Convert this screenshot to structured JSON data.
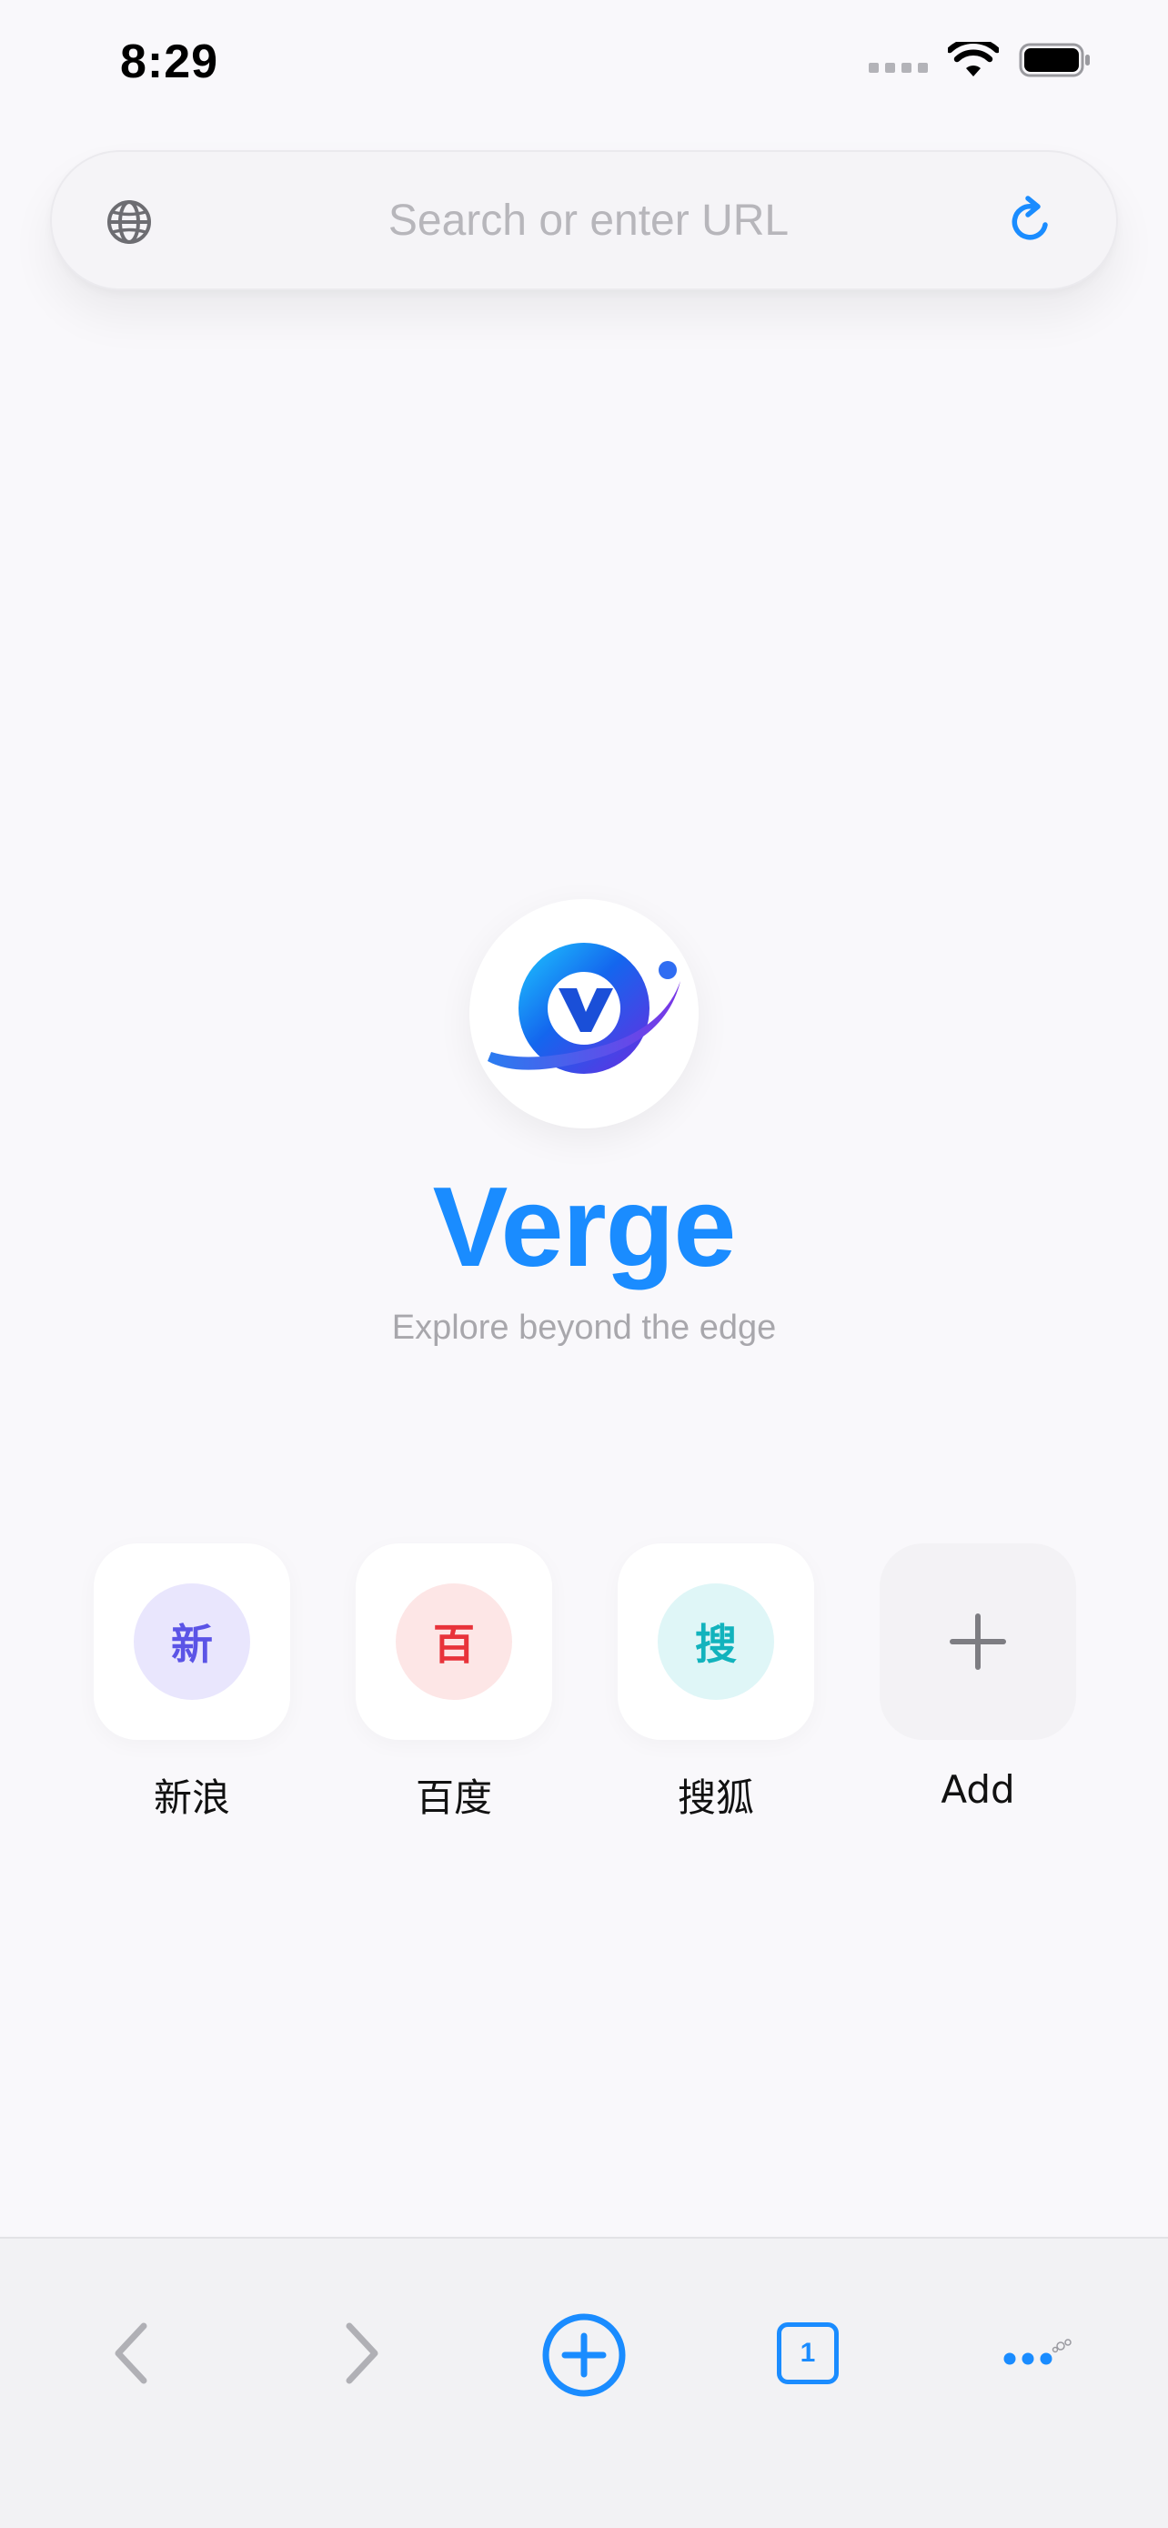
{
  "status_bar": {
    "time": "8:29"
  },
  "url_bar": {
    "placeholder": "Search or enter URL"
  },
  "brand": {
    "name": "Verge",
    "tagline": "Explore beyond the edge"
  },
  "shortcuts": [
    {
      "label": "新浪",
      "glyph": "新",
      "icon_bg": "#e9e6fd",
      "icon_fg": "#5b54e6"
    },
    {
      "label": "百度",
      "glyph": "百",
      "icon_bg": "#fde6e6",
      "icon_fg": "#e8333a"
    },
    {
      "label": "搜狐",
      "glyph": "搜",
      "icon_bg": "#dff6f7",
      "icon_fg": "#12b3bd"
    },
    {
      "label": "Add",
      "icon": "plus-icon"
    }
  ],
  "toolbar": {
    "tab_count": "1"
  },
  "colors": {
    "accent": "#1a8cff",
    "background": "#f9f8fb"
  }
}
